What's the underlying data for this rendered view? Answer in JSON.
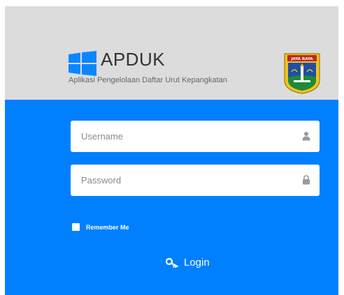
{
  "header": {
    "title": "APDUK",
    "subtitle": "Aplikasi Pengelolaan Daftar Urut Kepangkatan",
    "logo_icon": "windows-logo-icon",
    "emblem_icon": "jakarta-emblem-icon",
    "emblem_text": "JAYA RAYA"
  },
  "form": {
    "username": {
      "placeholder": "Username",
      "value": "",
      "icon": "user-icon"
    },
    "password": {
      "placeholder": "Password",
      "value": "",
      "icon": "lock-icon"
    },
    "remember_me": {
      "label": "Remember Me",
      "checked": false
    },
    "login": {
      "label": "Login",
      "icon": "key-icon"
    }
  },
  "colors": {
    "header_bg": "#dcdcdc",
    "panel_bg": "#0080ff",
    "logo_blue": "#0a86ff"
  }
}
